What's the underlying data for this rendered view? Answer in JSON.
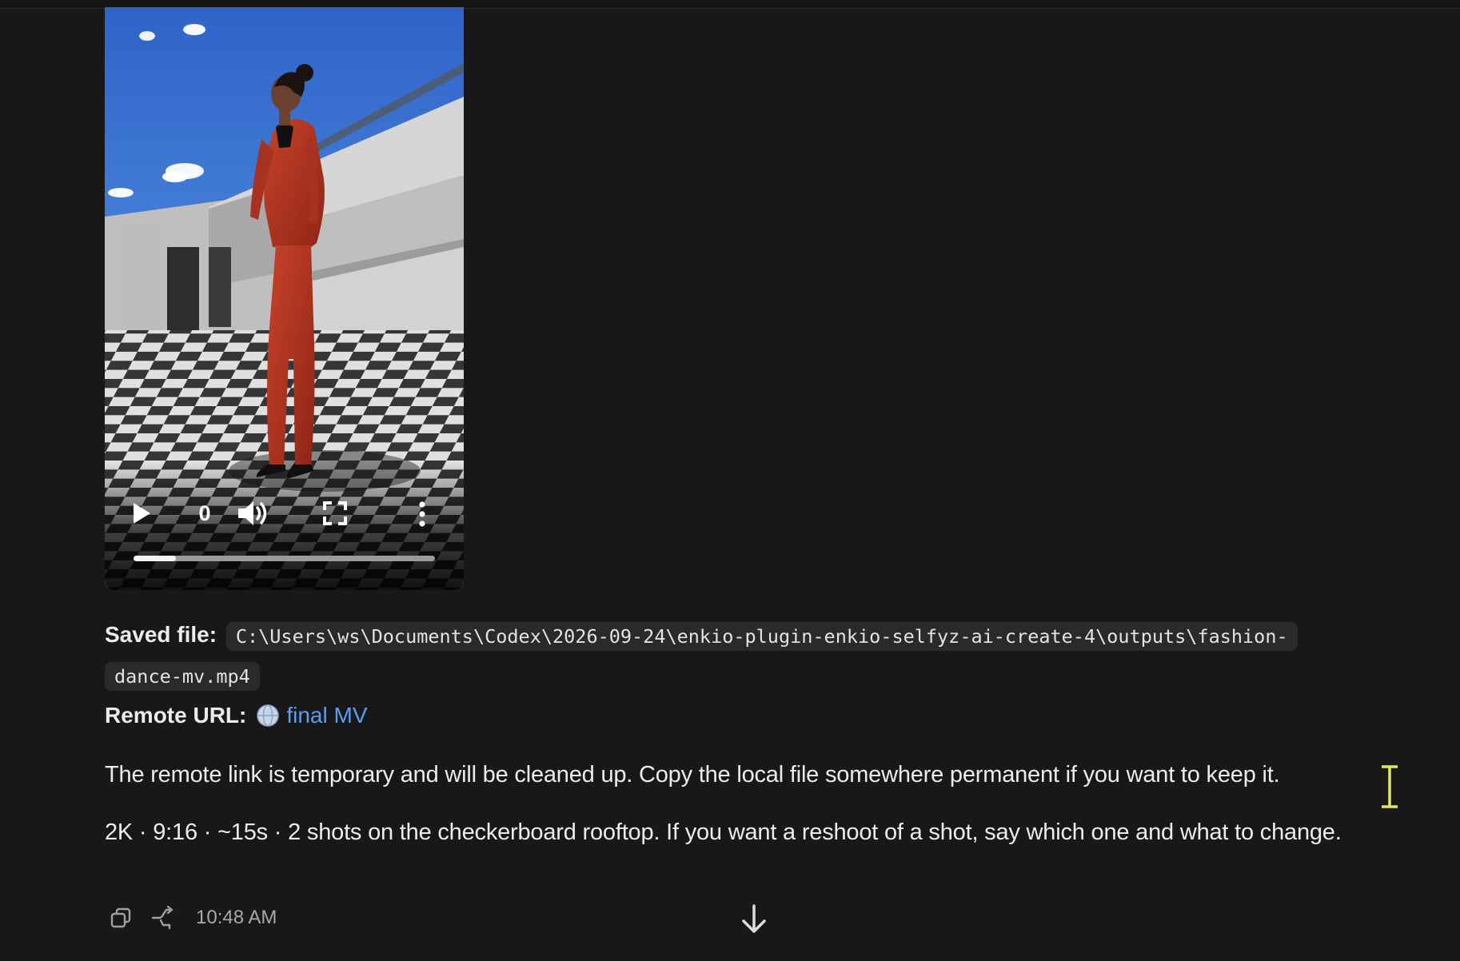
{
  "video": {
    "time_display": "0",
    "progress_fraction": 0.14,
    "icons": [
      "play-icon",
      "volume-icon",
      "fullscreen-icon",
      "more-vertical-icon"
    ]
  },
  "message": {
    "saved_file_label": "Saved file:",
    "saved_file_path_line1": "C:\\Users\\ws\\Documents\\Codex\\2026-09-24\\enkio-plugin-enkio-selfyz-ai-create-4\\outputs\\fashion-",
    "saved_file_path_line2": "dance-mv.mp4",
    "remote_url_label": "Remote URL:",
    "remote_link_text": "final MV",
    "paragraph_1": "The remote link is temporary and will be cleaned up. Copy the local file somewhere permanent if you want to keep it.",
    "paragraph_2": "2K · 9:16 · ~15s · 2 shots on the checkerboard rooftop. If you want a reshoot of a shot, say which one and what to change."
  },
  "actions": {
    "timestamp": "10:48 AM",
    "icons": [
      "copy-icon",
      "branch-icon",
      "arrow-down-icon"
    ]
  },
  "colors": {
    "background": "#181818",
    "link": "#5a9df2",
    "code_background": "#2a2a2a",
    "suit": "#b5331f"
  }
}
